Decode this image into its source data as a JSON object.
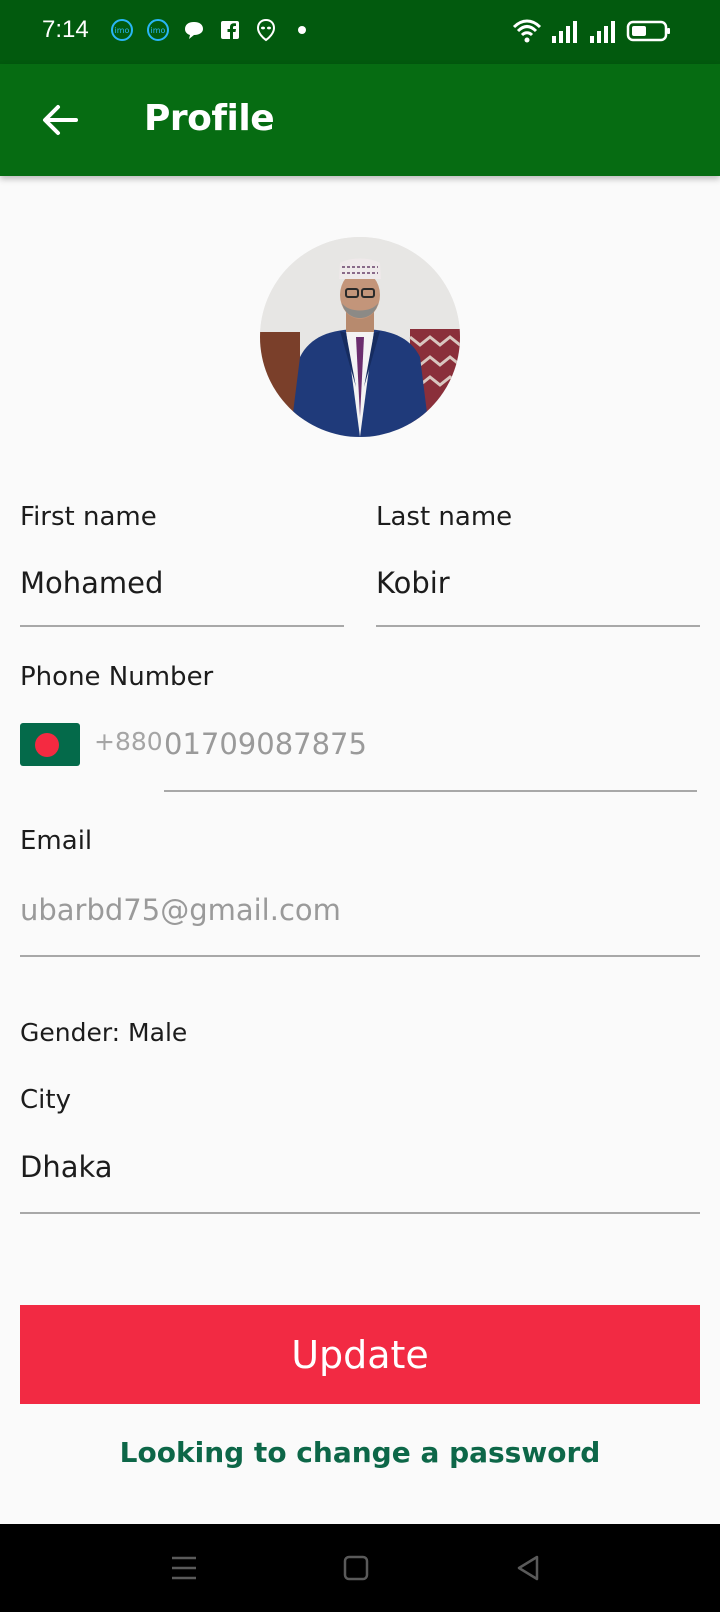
{
  "status_bar": {
    "time": "7:14",
    "left_icons": [
      "imo-icon",
      "imo-icon",
      "chat-icon",
      "facebook-icon",
      "alien-icon",
      "dot-icon"
    ],
    "right_icons": [
      "wifi-icon",
      "signal-icon",
      "signal-icon",
      "battery-icon"
    ]
  },
  "app_bar": {
    "title": "Profile",
    "back_icon": "arrow-left-icon"
  },
  "profile": {
    "first_name_label": "First name",
    "first_name_value": "Mohamed",
    "last_name_label": "Last name",
    "last_name_value": "Kobir",
    "phone_label": "Phone Number",
    "country_code": "+880",
    "phone_value": "01709087875",
    "email_label": "Email",
    "email_value": "ubarbd75@gmail.com",
    "gender_text": "Gender: Male",
    "city_label": "City",
    "city_value": "Dhaka"
  },
  "actions": {
    "update_label": "Update",
    "change_password_label": "Looking to change a password"
  },
  "colors": {
    "status_bar": "#025a0e",
    "app_bar": "#066c12",
    "update_button": "#f22a43",
    "link": "#0d6748"
  },
  "nav_bar": {
    "icons": [
      "menu-icon",
      "home-square-icon",
      "back-triangle-icon"
    ]
  }
}
